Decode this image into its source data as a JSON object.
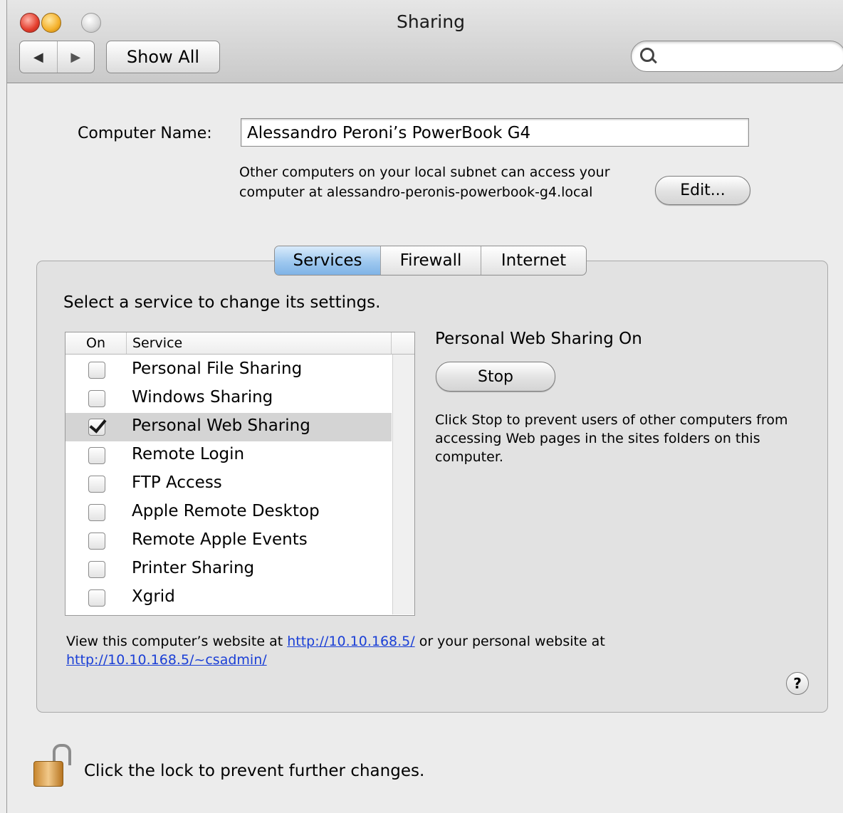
{
  "window": {
    "title": "Sharing",
    "nav_back": "◀",
    "nav_forward": "▶",
    "show_all": "Show All",
    "search_placeholder": ""
  },
  "computer_name": {
    "label": "Computer Name:",
    "value": "Alessandro Peroni’s PowerBook G4",
    "subnet_text": "Other computers on your local subnet can access your computer at alessandro-peronis-powerbook-g4.local",
    "edit_button": "Edit..."
  },
  "tabs": [
    {
      "label": "Services",
      "active": true
    },
    {
      "label": "Firewall",
      "active": false
    },
    {
      "label": "Internet",
      "active": false
    }
  ],
  "services_panel": {
    "hint": "Select a service to change its settings.",
    "header_on": "On",
    "header_service": "Service",
    "services": [
      {
        "name": "Personal File Sharing",
        "on": false
      },
      {
        "name": "Windows Sharing",
        "on": false
      },
      {
        "name": "Personal Web Sharing",
        "on": true
      },
      {
        "name": "Remote Login",
        "on": false
      },
      {
        "name": "FTP Access",
        "on": false
      },
      {
        "name": "Apple Remote Desktop",
        "on": false
      },
      {
        "name": "Remote Apple Events",
        "on": false
      },
      {
        "name": "Printer Sharing",
        "on": false
      },
      {
        "name": "Xgrid",
        "on": false
      }
    ],
    "selected_index": 2,
    "status": "Personal Web Sharing On",
    "stop_button": "Stop",
    "stop_description": "Click Stop to prevent users of other computers from accessing Web pages in the sites folders on this computer.",
    "website_prefix": "View this computer’s website at ",
    "website_link1": "http://10.10.168.5/",
    "website_middle": " or your personal website at ",
    "website_link2": "http://10.10.168.5/~csadmin/",
    "help_label": "?"
  },
  "lock": {
    "text": "Click the lock to prevent further changes."
  },
  "icons": {
    "search": "search-icon",
    "lock": "lock-open-icon",
    "help": "help-icon"
  }
}
